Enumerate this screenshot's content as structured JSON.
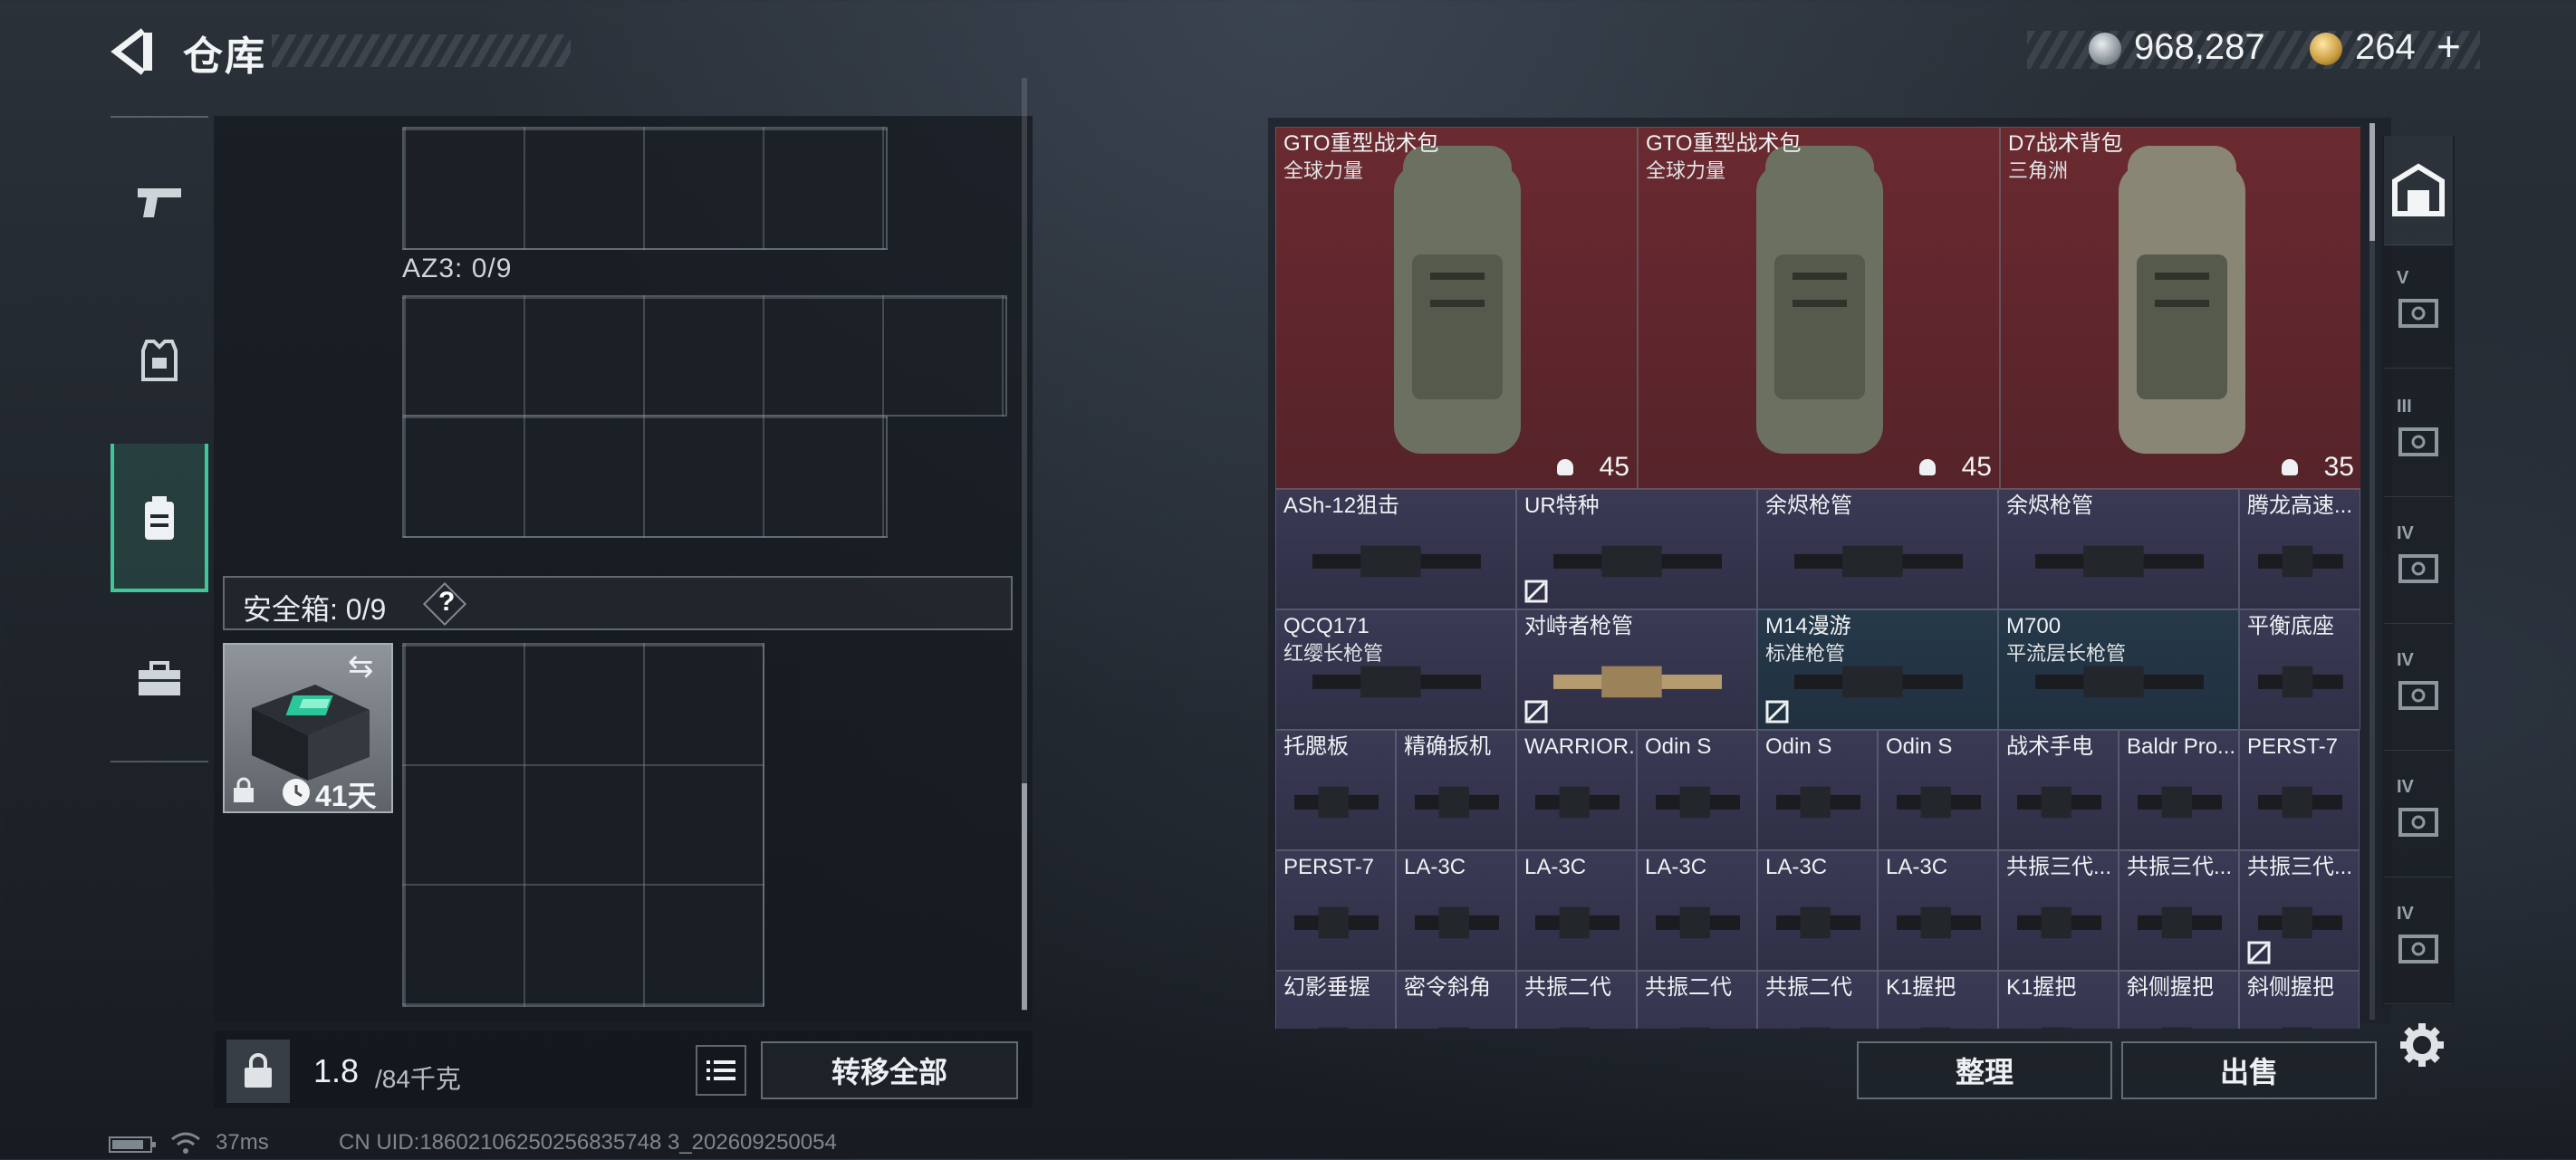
{
  "header": {
    "title": "仓库"
  },
  "currency": {
    "silver": "968,287",
    "gold": "264",
    "plus_label": "+"
  },
  "stash": {
    "az3_label": "AZ3: 0/9",
    "safe_label": "安全箱: 0/9",
    "help_label": "?",
    "safe_days": "41天",
    "weight_value": "1.8",
    "weight_cap": "/84千克",
    "transfer_all_label": "转移全部"
  },
  "inventory": {
    "items": [
      {
        "name": "GTO重型战术包",
        "sub": "全球力量",
        "count": "45"
      },
      {
        "name": "GTO重型战术包",
        "sub": "全球力量",
        "count": "45"
      },
      {
        "name": "D7战术背包",
        "sub": "三角洲",
        "count": "35"
      },
      {
        "name": "ASh-12狙击"
      },
      {
        "name": "UR特种"
      },
      {
        "name": "余烬枪管"
      },
      {
        "name": "余烬枪管"
      },
      {
        "name": "腾龙高速..."
      },
      {
        "name": "QCQ171",
        "sub": "红缨长枪管"
      },
      {
        "name": "对峙者枪管"
      },
      {
        "name": "M14漫游",
        "sub": "标准枪管"
      },
      {
        "name": "M700",
        "sub": "平流层长枪管"
      },
      {
        "name": "平衡底座"
      },
      {
        "name": "托腮板"
      },
      {
        "name": "精确扳机"
      },
      {
        "name": "WARRIOR..."
      },
      {
        "name": "Odin S"
      },
      {
        "name": "Odin S"
      },
      {
        "name": "Odin S"
      },
      {
        "name": "战术手电"
      },
      {
        "name": "Baldr Pro..."
      },
      {
        "name": "PERST-7"
      },
      {
        "name": "PERST-7"
      },
      {
        "name": "LA-3C"
      },
      {
        "name": "LA-3C"
      },
      {
        "name": "LA-3C"
      },
      {
        "name": "LA-3C"
      },
      {
        "name": "LA-3C"
      },
      {
        "name": "共振三代..."
      },
      {
        "name": "共振三代..."
      },
      {
        "name": "共振三代..."
      },
      {
        "name": "幻影垂握"
      },
      {
        "name": "密令斜角"
      },
      {
        "name": "共振二代"
      },
      {
        "name": "共振二代"
      },
      {
        "name": "共振二代"
      },
      {
        "name": "K1握把"
      },
      {
        "name": "K1握把"
      },
      {
        "name": "斜侧握把"
      },
      {
        "name": "斜侧握把"
      }
    ],
    "arrange_label": "整理",
    "sell_label": "出售"
  },
  "categories": [
    {
      "label": ""
    },
    {
      "label": "V"
    },
    {
      "label": "III"
    },
    {
      "label": "IV"
    },
    {
      "label": "IV"
    },
    {
      "label": "IV"
    },
    {
      "label": "IV"
    }
  ],
  "status": {
    "ping": "37ms",
    "uid": "CN UID:18602106250256835748 3_202609250054"
  },
  "colors": {
    "accent_green": "#3fc79a",
    "red_cell": "#5e262c",
    "purple_cell": "#35354f",
    "blue_cell": "#233545"
  }
}
